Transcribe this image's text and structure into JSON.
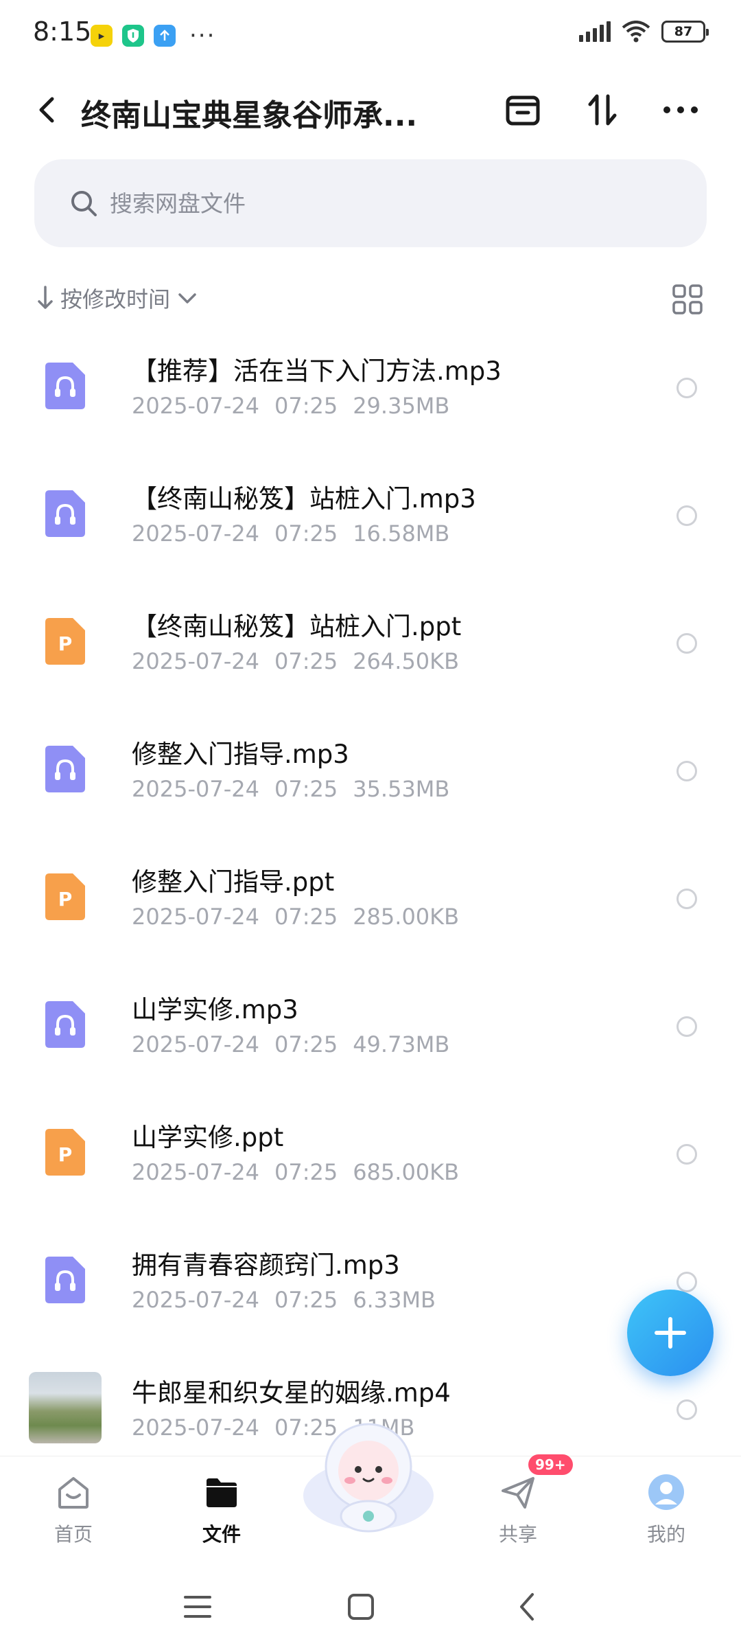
{
  "status_bar": {
    "time": "8:15",
    "more": "···",
    "battery": "87",
    "app_badges": [
      "bilibili",
      "shield",
      "upload"
    ]
  },
  "header": {
    "title": "终南山宝典星象谷师承...",
    "icons": [
      "back-arrow-icon",
      "archive-box-icon",
      "sort-arrows-icon",
      "more-dots-icon"
    ]
  },
  "search": {
    "placeholder": "搜索网盘文件",
    "value": ""
  },
  "sort": {
    "label": "按修改时间"
  },
  "files": [
    {
      "name": "【推荐】活在当下入门方法.mp3",
      "date": "2025-07-24",
      "time": "07:25",
      "size": "29.35MB",
      "type": "audio"
    },
    {
      "name": "【终南山秘笈】站桩入门.mp3",
      "date": "2025-07-24",
      "time": "07:25",
      "size": "16.58MB",
      "type": "audio"
    },
    {
      "name": "【终南山秘笈】站桩入门.ppt",
      "date": "2025-07-24",
      "time": "07:25",
      "size": "264.50KB",
      "type": "ppt"
    },
    {
      "name": "修整入门指导.mp3",
      "date": "2025-07-24",
      "time": "07:25",
      "size": "35.53MB",
      "type": "audio"
    },
    {
      "name": "修整入门指导.ppt",
      "date": "2025-07-24",
      "time": "07:25",
      "size": "285.00KB",
      "type": "ppt"
    },
    {
      "name": "山学实修.mp3",
      "date": "2025-07-24",
      "time": "07:25",
      "size": "49.73MB",
      "type": "audio"
    },
    {
      "name": "山学实修.ppt",
      "date": "2025-07-24",
      "time": "07:25",
      "size": "685.00KB",
      "type": "ppt"
    },
    {
      "name": "拥有青春容颜窍门.mp3",
      "date": "2025-07-24",
      "time": "07:25",
      "size": "6.33MB",
      "type": "audio"
    },
    {
      "name": "牛郎星和织女星的姻缘.mp4",
      "date": "2025-07-24",
      "time": "07:25",
      "size": "11MB",
      "type": "video"
    }
  ],
  "ppt_letter": "P",
  "colors": {
    "audio_icon": "#8f8ff5",
    "ppt_icon": "#f7a04b",
    "accent": "#2a8ff0",
    "badge": "#ff4d6d"
  },
  "bottom_nav": {
    "home": "首页",
    "files": "文件",
    "share": "共享",
    "mine": "我的",
    "share_badge": "99+"
  }
}
